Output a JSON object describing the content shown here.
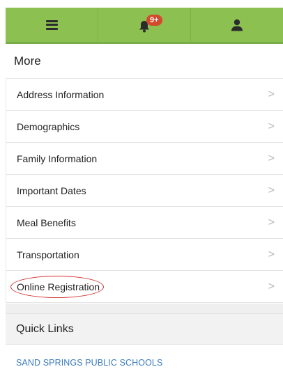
{
  "topbar": {
    "menu_icon": "hamburger-menu-icon",
    "notifications_icon": "bell-icon",
    "notifications_badge": "9+",
    "profile_icon": "user-icon",
    "bar_color": "#8cc152",
    "badge_color": "#d34a2c"
  },
  "more": {
    "title": "More",
    "items": [
      {
        "label": "Address Information"
      },
      {
        "label": "Demographics"
      },
      {
        "label": "Family Information"
      },
      {
        "label": "Important Dates"
      },
      {
        "label": "Meal Benefits"
      },
      {
        "label": "Transportation"
      },
      {
        "label": "Online Registration"
      }
    ],
    "chevron": ">"
  },
  "quick_links": {
    "title": "Quick Links",
    "links": [
      {
        "label": "SAND SPRINGS PUBLIC SCHOOLS"
      }
    ],
    "link_color": "#3a7bbf"
  },
  "annotation": {
    "circle_color": "#d32f2f"
  }
}
